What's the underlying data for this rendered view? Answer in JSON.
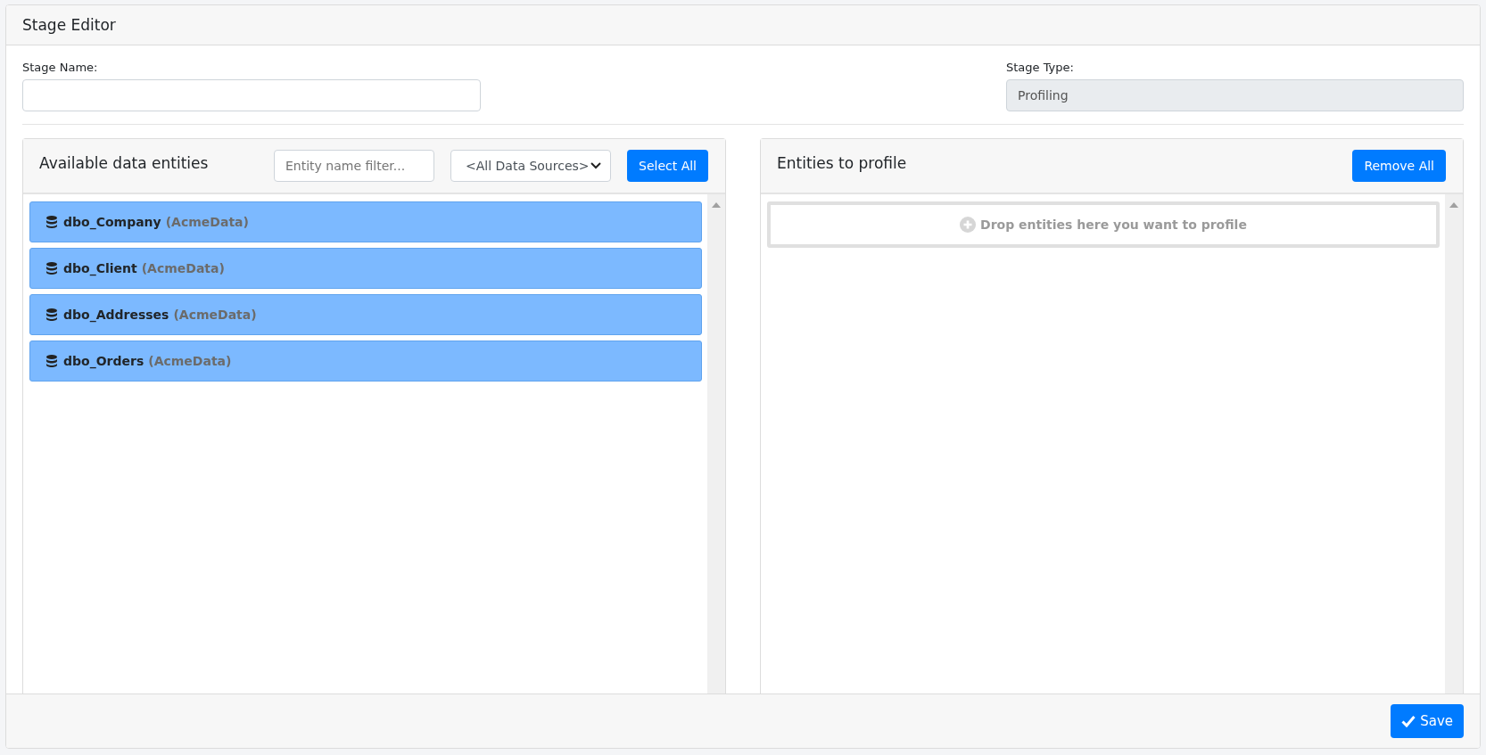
{
  "window": {
    "title": "Stage Editor"
  },
  "stage_name": {
    "label": "Stage Name:"
  },
  "stage_type": {
    "label": "Stage Type:",
    "value": "Profiling",
    "disabled": true
  },
  "available": {
    "title": "Available data entities",
    "filter": {
      "placeholder": "Entity name filter..."
    },
    "source_select": {
      "value": "<All Data Sources>"
    },
    "select_all": "Select All",
    "entities": [
      {
        "name": "dbo_Company",
        "source": "(AcmeData)"
      },
      {
        "name": "dbo_Client",
        "source": "(AcmeData)"
      },
      {
        "name": "dbo_Addresses",
        "source": "(AcmeData)"
      },
      {
        "name": "dbo_Orders",
        "source": "(AcmeData)"
      }
    ]
  },
  "to_profile": {
    "title": "Entities to profile",
    "remove_all": "Remove All",
    "drop_hint": "Drop entities here you want to profile"
  },
  "footer": {
    "save": "Save"
  }
}
